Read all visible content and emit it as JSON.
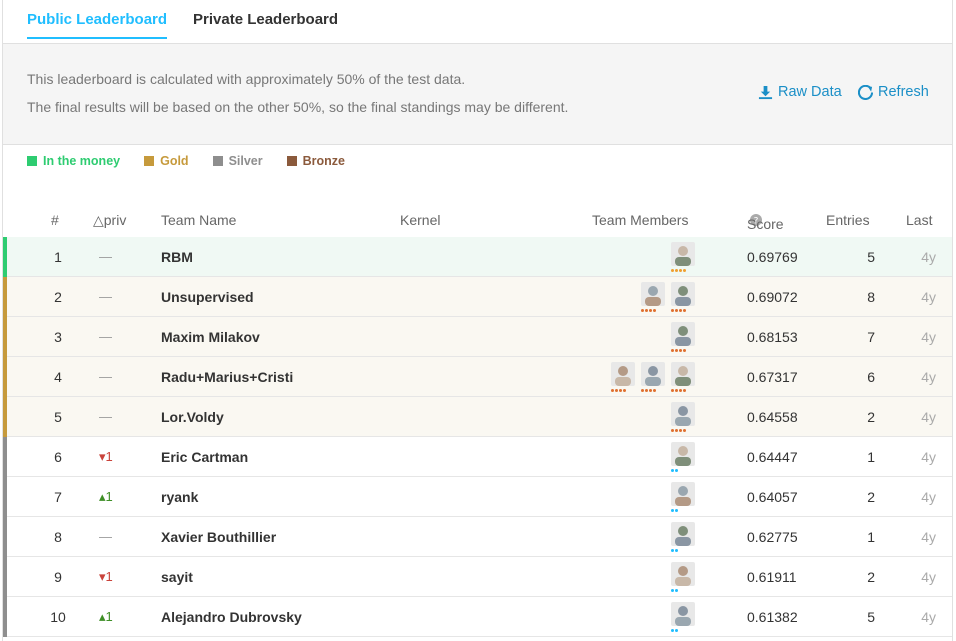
{
  "tabs": {
    "public": "Public Leaderboard",
    "private": "Private Leaderboard"
  },
  "notice": {
    "line1": "This leaderboard is calculated with approximately 50% of the test data.",
    "line2": "The final results will be based on the other 50%, so the final standings may be different.",
    "raw_data": "Raw Data",
    "refresh": "Refresh"
  },
  "legend": [
    {
      "label": "In the money",
      "color": "#2ecc71"
    },
    {
      "label": "Gold",
      "color": "#c69a3c"
    },
    {
      "label": "Silver",
      "color": "#8e8e8e"
    },
    {
      "label": "Bronze",
      "color": "#8b5a3c"
    }
  ],
  "columns": {
    "rank": "#",
    "delta": "△priv",
    "team": "Team Name",
    "kernel": "Kernel",
    "members": "Team Members",
    "score": "Score",
    "entries": "Entries",
    "last": "Last"
  },
  "rows": [
    {
      "rank": "1",
      "delta": "—",
      "dir": "none",
      "team": "RBM",
      "score": "0.69769",
      "entries": "5",
      "last": "4y",
      "tier": "money",
      "members": 1
    },
    {
      "rank": "2",
      "delta": "—",
      "dir": "none",
      "team": "Unsupervised",
      "score": "0.69072",
      "entries": "8",
      "last": "4y",
      "tier": "gold",
      "members": 2
    },
    {
      "rank": "3",
      "delta": "—",
      "dir": "none",
      "team": "Maxim Milakov",
      "score": "0.68153",
      "entries": "7",
      "last": "4y",
      "tier": "gold",
      "members": 1
    },
    {
      "rank": "4",
      "delta": "—",
      "dir": "none",
      "team": "Radu+Marius+Cristi",
      "score": "0.67317",
      "entries": "6",
      "last": "4y",
      "tier": "gold",
      "members": 3
    },
    {
      "rank": "5",
      "delta": "—",
      "dir": "none",
      "team": "Lor.Voldy",
      "score": "0.64558",
      "entries": "2",
      "last": "4y",
      "tier": "gold",
      "members": 1
    },
    {
      "rank": "6",
      "delta": "▾1",
      "dir": "down",
      "team": "Eric Cartman",
      "score": "0.64447",
      "entries": "1",
      "last": "4y",
      "tier": "silver",
      "members": 1
    },
    {
      "rank": "7",
      "delta": "▴1",
      "dir": "up",
      "team": "ryank",
      "score": "0.64057",
      "entries": "2",
      "last": "4y",
      "tier": "silver",
      "members": 1
    },
    {
      "rank": "8",
      "delta": "—",
      "dir": "none",
      "team": "Xavier Bouthillier",
      "score": "0.62775",
      "entries": "1",
      "last": "4y",
      "tier": "silver",
      "members": 1
    },
    {
      "rank": "9",
      "delta": "▾1",
      "dir": "down",
      "team": "sayit",
      "score": "0.61911",
      "entries": "2",
      "last": "4y",
      "tier": "silver",
      "members": 1
    },
    {
      "rank": "10",
      "delta": "▴1",
      "dir": "up",
      "team": "Alejandro Dubrovsky",
      "score": "0.61382",
      "entries": "5",
      "last": "4y",
      "tier": "silver",
      "members": 1
    }
  ],
  "tier_colors": {
    "money": "#2ecc71",
    "gold": "#c69a3c",
    "silver": "#8e8e8e",
    "bronze": "#8b5a3c"
  },
  "row_backgrounds": {
    "money": "#f0f9f4",
    "gold": "#faf8f2",
    "silver": "#ffffff"
  },
  "icons": {
    "raw_data": "download-icon",
    "refresh": "refresh-icon",
    "score_help": "help-icon"
  }
}
